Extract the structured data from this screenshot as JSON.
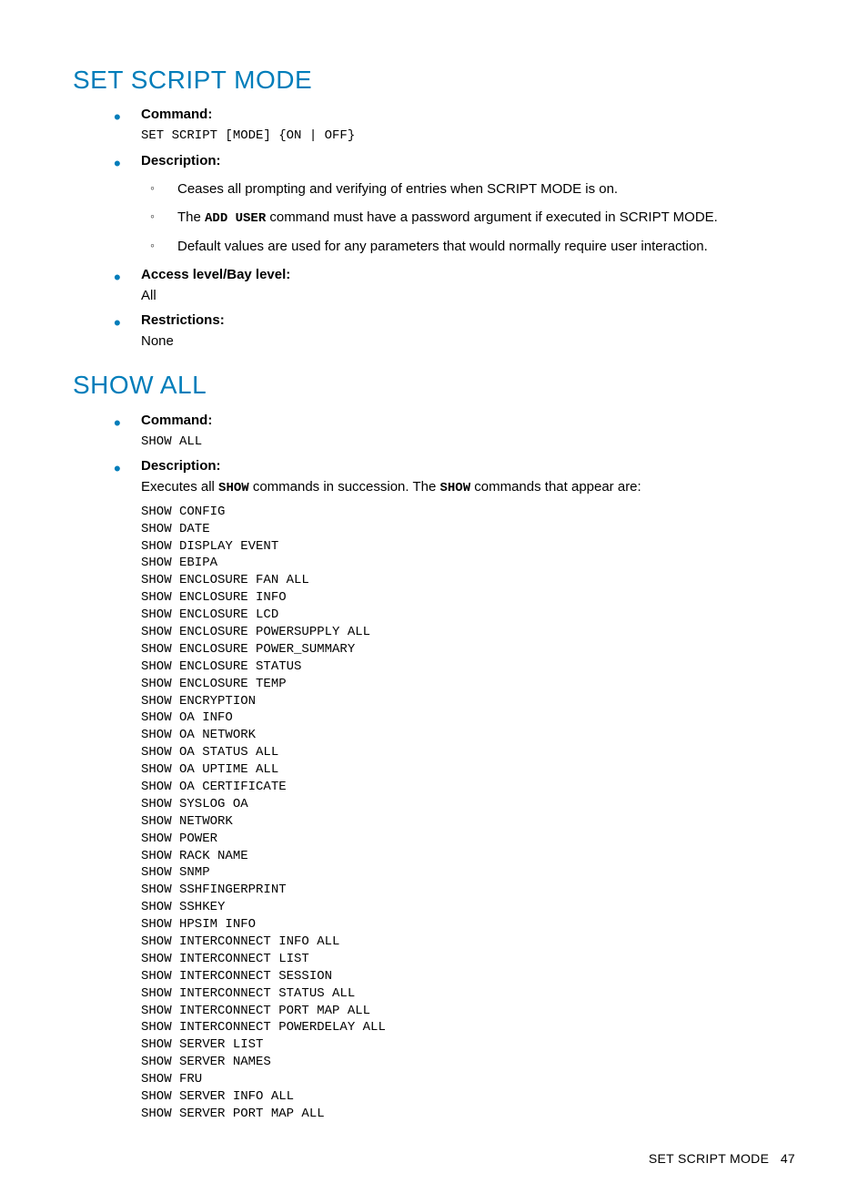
{
  "section1": {
    "title": "SET SCRIPT MODE",
    "command_label": "Command:",
    "command_text": "SET SCRIPT [MODE] {ON | OFF}",
    "description_label": "Description:",
    "desc_items": [
      "Ceases all prompting and verifying of entries when SCRIPT MODE is on.",
      "The __ADD USER__ command must have a password argument if executed in SCRIPT MODE.",
      "Default values are used for any parameters that would normally require user interaction."
    ],
    "access_label": "Access level/Bay level:",
    "access_value": "All",
    "restrictions_label": "Restrictions:",
    "restrictions_value": "None"
  },
  "section2": {
    "title": "SHOW ALL",
    "command_label": "Command:",
    "command_text": "SHOW ALL",
    "description_label": "Description:",
    "description_text": "Executes all __SHOW__ commands in succession. The __SHOW__ commands that appear are:",
    "code_lines": [
      "SHOW CONFIG",
      "SHOW DATE",
      "SHOW DISPLAY EVENT",
      "SHOW EBIPA",
      "SHOW ENCLOSURE FAN ALL",
      "SHOW ENCLOSURE INFO",
      "SHOW ENCLOSURE LCD",
      "SHOW ENCLOSURE POWERSUPPLY ALL",
      "SHOW ENCLOSURE POWER_SUMMARY",
      "SHOW ENCLOSURE STATUS",
      "SHOW ENCLOSURE TEMP",
      "SHOW ENCRYPTION",
      "SHOW OA INFO",
      "SHOW OA NETWORK",
      "SHOW OA STATUS ALL",
      "SHOW OA UPTIME ALL",
      "SHOW OA CERTIFICATE",
      "SHOW SYSLOG OA",
      "SHOW NETWORK",
      "SHOW POWER",
      "SHOW RACK NAME",
      "SHOW SNMP",
      "SHOW SSHFINGERPRINT",
      "SHOW SSHKEY",
      "SHOW HPSIM INFO",
      "SHOW INTERCONNECT INFO ALL",
      "SHOW INTERCONNECT LIST",
      "SHOW INTERCONNECT SESSION",
      "SHOW INTERCONNECT STATUS ALL",
      "SHOW INTERCONNECT PORT MAP ALL",
      "SHOW INTERCONNECT POWERDELAY ALL",
      "SHOW SERVER LIST",
      "SHOW SERVER NAMES",
      "SHOW FRU",
      "SHOW SERVER INFO ALL",
      "SHOW SERVER PORT MAP ALL"
    ]
  },
  "footer": {
    "text": "SET SCRIPT MODE",
    "page": "47"
  }
}
